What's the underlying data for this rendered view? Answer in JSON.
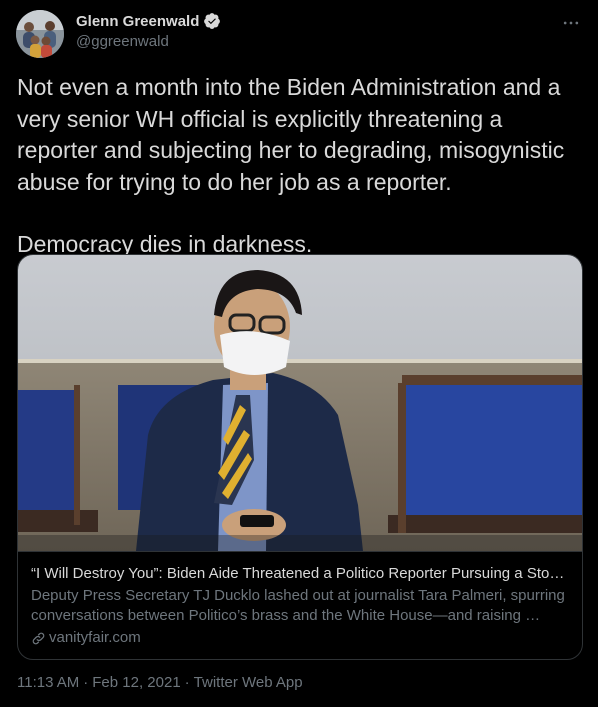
{
  "author": {
    "display_name": "Glenn Greenwald",
    "handle": "@ggreenwald",
    "verified": true,
    "avatar_icon": "avatar-photo-icon",
    "verified_icon": "verified-badge-icon"
  },
  "more_icon": "more-options-icon",
  "tweet": {
    "paragraphs": [
      "Not even a month into the Biden Administration and a very senior WH official is explicitly threatening a reporter and subjecting her to degrading, misogynistic abuse for trying to do her job as a reporter.",
      "Democracy dies in darkness."
    ]
  },
  "card": {
    "image_icon": "article-photo",
    "title": "“I Will Destroy You”: Biden Aide Threatened a Politico Reporter Pursuing a Story About His Relationship",
    "description": "Deputy Press Secretary TJ Ducklo lashed out at journalist Tara Palmeri, spurring conversations between Politico’s brass and the White House—and raising …",
    "domain": "vanityfair.com",
    "link_icon": "link-icon"
  },
  "meta": {
    "time": "11:13 AM",
    "separator": "·",
    "date": "Feb 12, 2021",
    "source": "Twitter Web App"
  },
  "colors": {
    "background": "#000000",
    "text": "#d9d9d9",
    "secondary": "#6e767d",
    "border": "#2f3336",
    "verified": "#d9d9d9"
  }
}
